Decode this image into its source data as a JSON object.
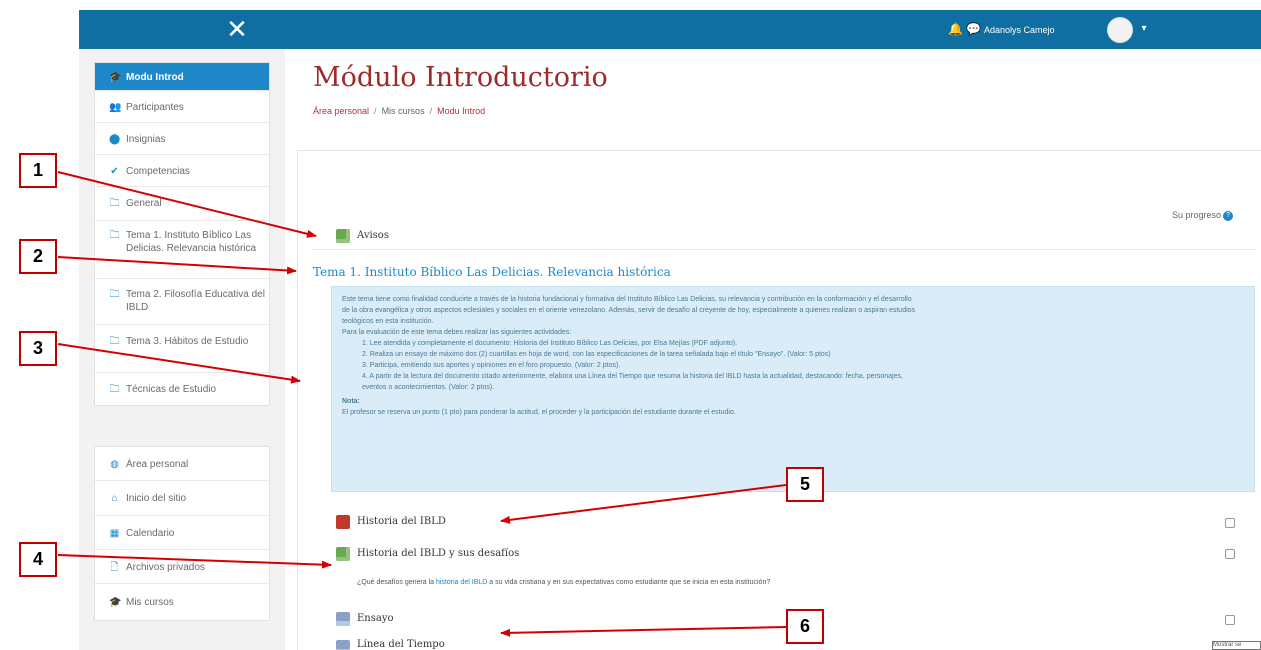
{
  "navbar": {
    "close_glyph": "✕",
    "user_name": "Adanolys Camejo",
    "bell_glyph": "🔔",
    "chat_glyph": "💬",
    "caret_glyph": "▾"
  },
  "nav_primary": [
    {
      "label": "Modu Introd",
      "icon": "graduation-cap-icon",
      "glyph": "🎓"
    },
    {
      "label": "Participantes",
      "icon": "users-icon",
      "glyph": "👥"
    },
    {
      "label": "Insignias",
      "icon": "badge-icon",
      "glyph": "⬤"
    },
    {
      "label": "Competencias",
      "icon": "check-icon",
      "glyph": "✔"
    },
    {
      "label": "General",
      "icon": "folder-icon",
      "glyph": "🗀"
    },
    {
      "label": "Tema 1. Instituto Bíblico Las Delicias. Relevancia histórica",
      "icon": "folder-icon",
      "glyph": "🗀"
    },
    {
      "label": "Tema 2. Filosofía Educativa del IBLD",
      "icon": "folder-icon",
      "glyph": "🗀"
    },
    {
      "label": "Tema 3. Hábitos de Estudio",
      "icon": "folder-icon",
      "glyph": "🗀"
    },
    {
      "label": "Técnicas de Estudio",
      "icon": "folder-icon",
      "glyph": "🗀"
    }
  ],
  "nav_secondary": [
    {
      "label": "Área personal",
      "icon": "dashboard-icon",
      "glyph": "◍"
    },
    {
      "label": "Inicio del sitio",
      "icon": "home-icon",
      "glyph": "⌂"
    },
    {
      "label": "Calendario",
      "icon": "calendar-icon",
      "glyph": "▦"
    },
    {
      "label": "Archivos privados",
      "icon": "file-icon",
      "glyph": "🗋"
    },
    {
      "label": "Mis cursos",
      "icon": "graduation-cap-icon",
      "glyph": "🎓"
    }
  ],
  "page": {
    "title": "Módulo Introductorio",
    "breadcrumb": [
      "Área personal",
      "Mis cursos",
      "Modu Introd"
    ],
    "breadcrumb_sep": "/",
    "progress_label": "Su progreso",
    "help_glyph": "?"
  },
  "section0": {
    "forum_name": "Avisos"
  },
  "section1": {
    "title": "Tema 1. Instituto Bíblico Las Delicias. Relevancia histórica",
    "summary_lines": [
      "Este tema tiene como finalidad conducirte a través de la historia fundacional y formativa del Instituto Bíblico Las Delicias, su relevancia y contribución en la conformación y el desarrollo",
      "de la obra evangélica y otros aspectos eclesiales y sociales en el oriente venezolano. Además, servir de desafío al creyente de hoy, especialmente a quienes realizan o aspiran estudios",
      "teológicos en esta institución.",
      "Para la evaluación de este tema debes realizar las siguientes actividades:",
      "1. Lee atendida y completamente el documento: Historia del Instituto Bíblico Las Delicias, por Elsa Mejías (PDF adjunto).",
      "2. Realiza un ensayo de máximo dos (2) cuartillas en hoja de word, con las especificaciones de la tarea señalada bajo el título \"Ensayo\". (Valor: 5 ptos)",
      "3. Participa, emitiendo sus aportes y opiniones en el foro propuesto. (Valor: 2 ptos).",
      "4. A partir de la lectura del documento citado anteriormente, elabora una Línea del Tiempo que resuma la historia del IBLD hasta la actualidad, destacando: fecha, personajes,",
      "eventos o acontecimientos. (Valor: 2 ptos).",
      "Nota:",
      "El profesor se reserva un punto (1 pto) para ponderar la actitud, el proceder y la participación del estudiante durante el estudio."
    ],
    "activities": [
      {
        "name": "Historia del IBLD",
        "type": "pdf-icon"
      },
      {
        "name": "Historia del IBLD y sus desafíos",
        "type": "forum-icon"
      },
      {
        "name": "Ensayo",
        "type": "assign-icon"
      },
      {
        "name": "Línea del Tiempo",
        "type": "assign-icon"
      }
    ],
    "forum_description": {
      "before": "¿Qué desafíos genera la ",
      "link": "historia del IBLD",
      "after": " a su vida cristiana y en sus expectativas como estudiante que se inicia en esta institución?"
    }
  },
  "tooltip": "Mostrar se",
  "callouts": [
    "1",
    "2",
    "3",
    "4",
    "5",
    "6"
  ],
  "colors": {
    "navbar": "#0f6fa3",
    "active_nav": "#1e88c8",
    "title": "#9f2a2a",
    "callout_border": "#c00000",
    "arrow": "#d40000"
  }
}
